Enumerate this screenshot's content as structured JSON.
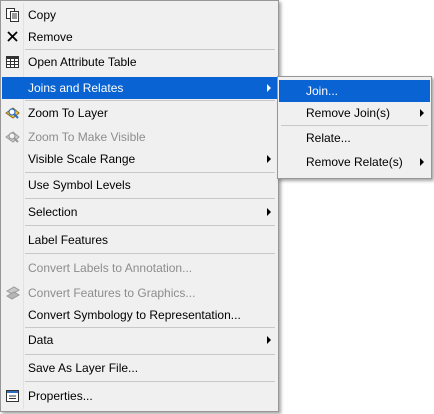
{
  "context_menu": {
    "copy": "Copy",
    "remove": "Remove",
    "open_attribute_table": "Open Attribute Table",
    "joins_and_relates": "Joins and Relates",
    "zoom_to_layer": "Zoom To Layer",
    "zoom_to_make_visible": "Zoom To Make Visible",
    "visible_scale_range": "Visible Scale Range",
    "use_symbol_levels": "Use Symbol Levels",
    "selection": "Selection",
    "label_features": "Label Features",
    "convert_labels": "Convert Labels to Annotation...",
    "convert_features": "Convert Features to Graphics...",
    "convert_symbology": "Convert Symbology to Representation...",
    "data": "Data",
    "save_as_layer_file": "Save As Layer File...",
    "properties": "Properties..."
  },
  "joins_submenu": {
    "join": "Join...",
    "remove_joins": "Remove Join(s)",
    "relate": "Relate...",
    "remove_relates": "Remove Relate(s)"
  },
  "colors": {
    "highlight": "#0a63d2",
    "menu_bg": "#f0f0f0",
    "disabled_text": "#8d8d8d"
  }
}
